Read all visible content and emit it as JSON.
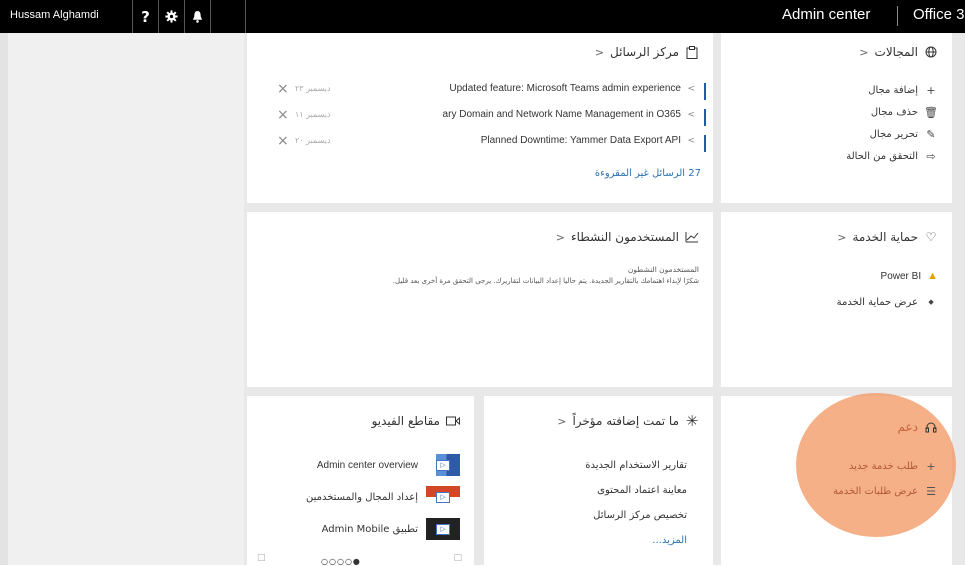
{
  "topbar": {
    "user_name": "Hussam Alghamdi",
    "help_icon": "help-icon",
    "settings_icon": "gear-icon",
    "bell_icon": "bell-icon",
    "admin_center": "Admin center",
    "office": "Office 3"
  },
  "message_center": {
    "title": "مركز الرسائل",
    "messages": [
      {
        "text": "Updated feature: Microsoft Teams admin experience",
        "date": "ديسمبر ٢٣"
      },
      {
        "text": "ary Domain and Network Name Management in O365",
        "date": "ديسمبر ١١"
      },
      {
        "text": "Planned Downtime: Yammer Data Export API",
        "date": "ديسمبر ٢٠"
      }
    ],
    "unread": "27 الرسائل غير المقروءة"
  },
  "domains": {
    "title": "المجالات",
    "actions": [
      "إضافة مجال",
      "حذف مجال",
      "تحرير مجال",
      "التحقق من الحالة"
    ]
  },
  "active_users": {
    "title": "المستخدمون النشطاء",
    "subtitle": "المستخدمون النشطون",
    "body": "شكرًا لإبداء اهتمامك بالتقارير الجديدة. يتم حاليا إعداد البيانات لتقاريرك. يرجى التحقق مرة أخرى بعد قليل."
  },
  "service_health": {
    "title": "حماية الخدمة",
    "warning_item": "Power BI",
    "view_link": "عرض حماية الخدمة"
  },
  "videos": {
    "title": "مقاطع الفيديو",
    "items": [
      "Admin center overview",
      "إعداد المجال والمستخدمين",
      "تطبيق Admin Mobile"
    ]
  },
  "whats_new": {
    "title": "ما تمت إضافته مؤخراً",
    "items": [
      "تقارير الاستخدام الجديدة",
      "معاينة اعتماد المحتوى",
      "تخصيص مركز الرسائل"
    ],
    "more": "المزيد..."
  },
  "support": {
    "title": "دعم",
    "actions": [
      "طلب خدمة جديد",
      "عرض طلبات الخدمة"
    ]
  },
  "colors": {
    "accent": "#1f5ba8",
    "highlight": "#f19660",
    "warning": "#e8a000"
  }
}
